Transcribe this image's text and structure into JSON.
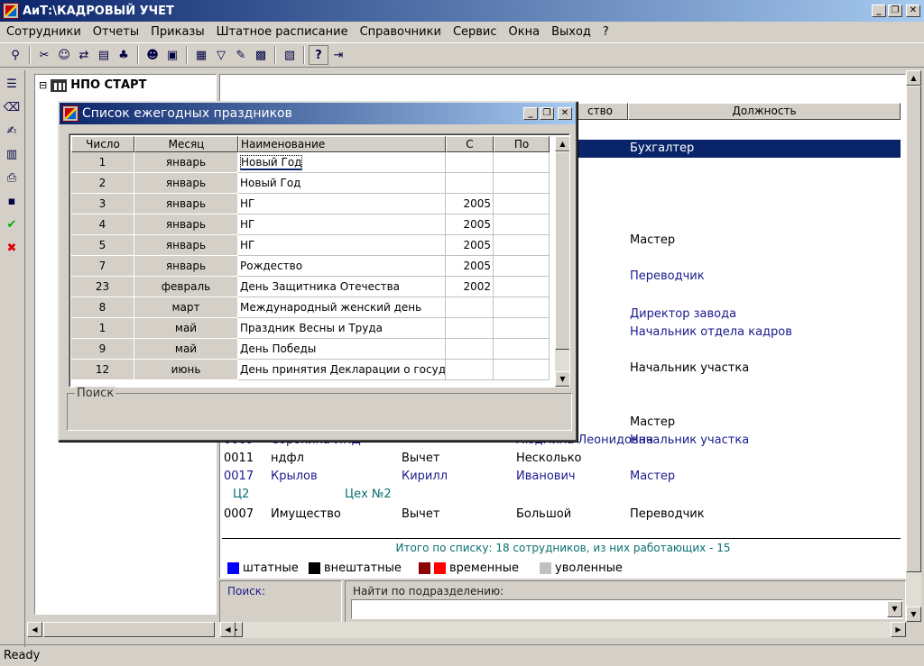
{
  "app": {
    "title": "АиТ:\\КАДРОВЫЙ УЧЕТ",
    "status": "Ready",
    "minimize": "_",
    "restore": "❐",
    "close": "✕"
  },
  "menu": [
    "Сотрудники",
    "Отчеты",
    "Приказы",
    "Штатное расписание",
    "Справочники",
    "Сервис",
    "Окна",
    "Выход",
    "?"
  ],
  "toolbar": {
    "icons": [
      "employee-search-icon",
      "tools-icon",
      "person-icon",
      "transfer-icon",
      "document-icon",
      "tree-icon",
      "people-icon",
      "print-preview-icon",
      "calculator-icon",
      "filter-icon",
      "edit-icon",
      "save-icon",
      "grid-icon",
      "help-icon",
      "exit-door-icon"
    ],
    "help": "?"
  },
  "sidebar_tools": [
    "tree-view-icon",
    "eraser-icon",
    "document-edit-icon",
    "card-icon",
    "printer-icon",
    "disk-save-icon",
    "checkmark-icon",
    "cancel-x-icon"
  ],
  "tree": {
    "root": "НПО СТАРТ",
    "expander": "⊟"
  },
  "main": {
    "header_partial": "ство",
    "header_position": "Должность",
    "rows": [
      {
        "c1": "",
        "c2": "",
        "c3": "",
        "c4": "Бухгалтер",
        "selected": true,
        "color": "#ffffff"
      },
      {
        "c1": "",
        "c2": "",
        "c3": "ич",
        "c4": "",
        "color": "#000000"
      },
      {
        "c1": "",
        "c2": "",
        "c3": "рвич",
        "c4": "Мастер",
        "color": "#000000"
      },
      {
        "c1": "",
        "c2": "",
        "c3": "ич",
        "c4": "",
        "color": "#000000"
      },
      {
        "c1": "",
        "c2": "",
        "c3": "овна",
        "c4": "Переводчик",
        "color": "#1a1a8c"
      },
      {
        "c1": "",
        "c2": "",
        "c3": "",
        "c4": "Директор завода",
        "color": "#1a1a8c"
      },
      {
        "c1": "",
        "c2": "",
        "c3": "",
        "c4": "Начальник отдела кадров",
        "color": "#1a1a8c"
      },
      {
        "c1": "",
        "c2": "",
        "c3": "",
        "c4": "Начальник участка",
        "color": "#000000"
      },
      {
        "c1": "",
        "c2": "",
        "c3": "Н",
        "c4": "Мастер",
        "color": "#000000"
      },
      {
        "c1": "0009",
        "c2": "Сорокина ИНД",
        "c3": "Людмила Леонидовна",
        "c4": "Начальник участка",
        "color": "#1a1a8c"
      },
      {
        "c1": "0011",
        "c2": "ндфл",
        "c3b": "Вычет",
        "c3": "Несколько",
        "c4": "",
        "color": "#000000"
      },
      {
        "c1": "0017",
        "c2": "Крылов",
        "c3b": "Кирилл",
        "c3": "Иванович",
        "c4": "Мастер",
        "color": "#1a1a8c"
      },
      {
        "c1": "Ц2",
        "c2": "Цех №2",
        "c3": "",
        "c4": "",
        "color": "#0a7070"
      },
      {
        "c1": "0007",
        "c2": "Имущество",
        "c3b": "Вычет",
        "c3": "Большой",
        "c4": "Переводчик",
        "color": "#000000"
      }
    ],
    "total": "Итого по списку: 18 сотрудников, из них работающих - 15",
    "legend": [
      {
        "label": "штатные",
        "color": "#0000ff"
      },
      {
        "label": "внештатные",
        "color": "#000000"
      },
      {
        "label": "временные",
        "color": "#8b0000",
        "color2": "#ff0000"
      },
      {
        "label": "уволенные",
        "color": "#c0c0c0"
      }
    ],
    "search_label": "Поиск:",
    "dept_search_label": "Найти по подразделению:"
  },
  "dialog": {
    "title": "Список ежегодных праздников",
    "columns": [
      "Число",
      "Месяц",
      "Наименование",
      "С",
      "По"
    ],
    "rows": [
      {
        "day": "1",
        "month": "январь",
        "name": "Новый Год",
        "from": "",
        "to": "",
        "focused": true
      },
      {
        "day": "2",
        "month": "январь",
        "name": "Новый Год",
        "from": "",
        "to": ""
      },
      {
        "day": "3",
        "month": "январь",
        "name": "НГ",
        "from": "2005",
        "to": ""
      },
      {
        "day": "4",
        "month": "январь",
        "name": "НГ",
        "from": "2005",
        "to": ""
      },
      {
        "day": "5",
        "month": "январь",
        "name": "НГ",
        "from": "2005",
        "to": ""
      },
      {
        "day": "7",
        "month": "январь",
        "name": "Рождество",
        "from": "2005",
        "to": ""
      },
      {
        "day": "23",
        "month": "февраль",
        "name": "День Защитника Отечества",
        "from": "2002",
        "to": ""
      },
      {
        "day": "8",
        "month": "март",
        "name": "Международный женский день",
        "from": "",
        "to": ""
      },
      {
        "day": "1",
        "month": "май",
        "name": "Праздник Весны и Труда",
        "from": "",
        "to": ""
      },
      {
        "day": "9",
        "month": "май",
        "name": "День Победы",
        "from": "",
        "to": ""
      },
      {
        "day": "12",
        "month": "июнь",
        "name": "День принятия Декларации о госуд",
        "from": "",
        "to": ""
      }
    ],
    "search_label": "Поиск"
  }
}
